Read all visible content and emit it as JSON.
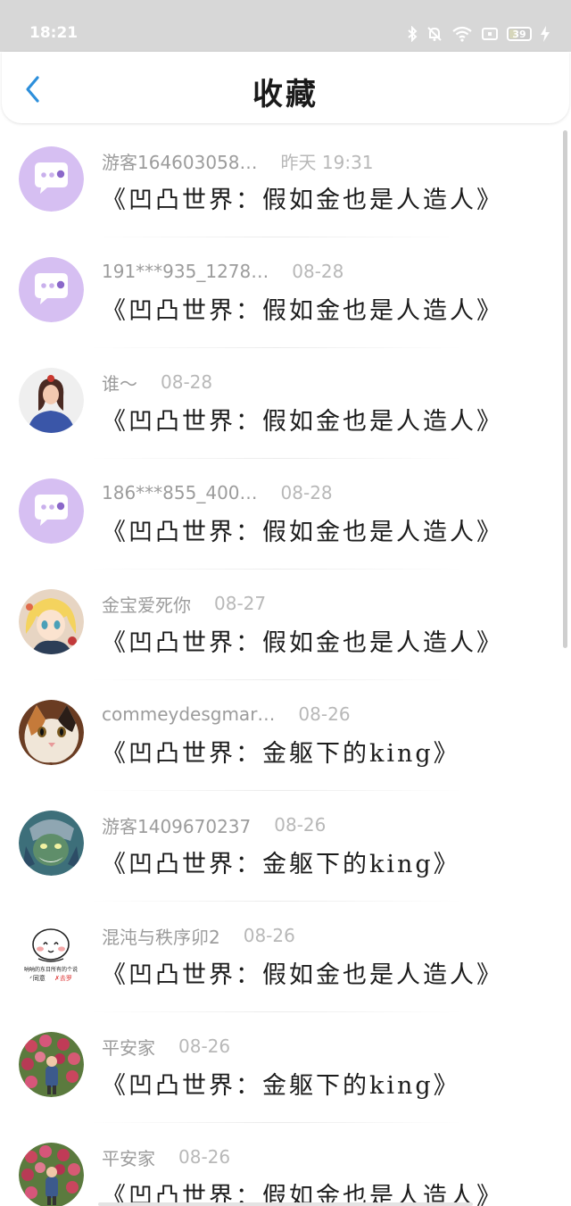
{
  "status_bar": {
    "time": "18:21",
    "icons": [
      "bluetooth-icon",
      "bell-muted-icon",
      "wifi-icon",
      "screen-icon"
    ],
    "battery": "39",
    "charging_icon": "lightning-icon"
  },
  "header": {
    "title": "收藏",
    "back_icon": "chevron-left-icon",
    "accent_color": "#2d8fdb"
  },
  "favorites": [
    {
      "name": "游客164603058…",
      "time": "昨天 19:31",
      "content": "《凹凸世界：假如金也是人造人》",
      "avatar": "chat-bubble-avatar"
    },
    {
      "name": "191***935_1278…",
      "time": "08-28",
      "content": "《凹凸世界：假如金也是人造人》",
      "avatar": "chat-bubble-avatar"
    },
    {
      "name": "谁～",
      "time": "08-28",
      "content": "《凹凸世界：假如金也是人造人》",
      "avatar": "girl-photo-avatar"
    },
    {
      "name": "186***855_400…",
      "time": "08-28",
      "content": "《凹凸世界：假如金也是人造人》",
      "avatar": "chat-bubble-avatar"
    },
    {
      "name": "金宝爱死你",
      "time": "08-27",
      "content": "《凹凸世界：假如金也是人造人》",
      "avatar": "anime-blonde-avatar"
    },
    {
      "name": "commeydesgmar…",
      "time": "08-26",
      "content": "《凹凸世界：金躯下的king》",
      "avatar": "cat-photo-avatar"
    },
    {
      "name": "游客1409670237",
      "time": "08-26",
      "content": "《凹凸世界：金躯下的king》",
      "avatar": "game-hero-avatar"
    },
    {
      "name": "混沌与秩序卯2",
      "time": "08-26",
      "content": "《凹凸世界：假如金也是人造人》",
      "avatar": "meme-sticker-avatar",
      "sticker_text": [
        "呐呐的东日所有的个说",
        "同意",
        "去罗"
      ]
    },
    {
      "name": "平安家",
      "time": "08-26",
      "content": "《凹凸世界：金躯下的king》",
      "avatar": "flower-photo-avatar"
    },
    {
      "name": "平安家",
      "time": "08-26",
      "content": "《凹凸世界：假如金也是人造人》",
      "avatar": "flower-photo-avatar"
    }
  ]
}
